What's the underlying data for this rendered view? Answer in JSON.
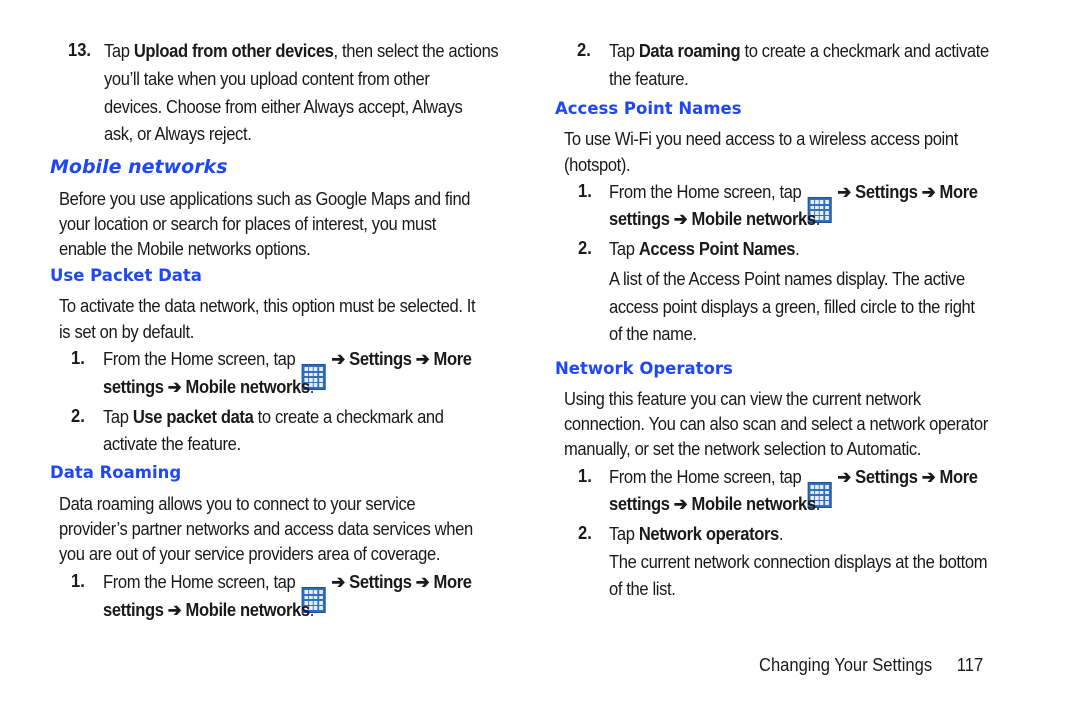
{
  "left_column": {
    "step13": {
      "number": "13.",
      "lines": [
        {
          "pre": "Tap ",
          "bold": "Upload from other devices",
          "post": ", then select the actions"
        },
        {
          "pre": "you’ll take when you upload content from other"
        },
        {
          "pre": "devices. Choose from either Always accept, Always"
        },
        {
          "pre": "ask, or Always reject."
        }
      ]
    },
    "mobile_networks": {
      "heading": "Mobile networks",
      "intro": [
        "Before you use applications such as Google Maps and find",
        "your location or search for places of interest, you must",
        "enable the Mobile networks options."
      ]
    },
    "use_packet_data": {
      "heading": "Use Packet Data",
      "intro": [
        "To activate the data network, this option must be selected. It",
        "is set on by default."
      ],
      "steps": [
        {
          "number": "1.",
          "line1_pre": "From the Home screen, tap ",
          "line1_post": " ➔ Settings ➔ More",
          "line2_bold": "settings ➔ Mobile networks",
          "line2_post": "."
        },
        {
          "number": "2.",
          "line1_pre": "Tap ",
          "line1_bold": "Use packet data",
          "line1_post": " to create a checkmark and",
          "line2": "activate the feature."
        }
      ]
    },
    "data_roaming": {
      "heading": "Data Roaming",
      "intro": [
        "Data roaming allows you to connect to your service",
        "provider’s partner networks and access data services when",
        "you are out of your service providers area of coverage."
      ],
      "steps": [
        {
          "number": "1.",
          "line1_pre": "From the Home screen, tap ",
          "line1_post": " ➔ Settings ➔ More",
          "line2_bold": "settings ➔ Mobile networks",
          "line2_post": "."
        }
      ]
    }
  },
  "right_column": {
    "data_roaming_step2": {
      "number": "2.",
      "line1_pre": "Tap ",
      "line1_bold": "Data roaming",
      "line1_post": " to create a checkmark and activate",
      "line2": "the feature."
    },
    "access_point_names": {
      "heading": "Access Point Names",
      "intro": [
        "To use Wi-Fi you need access to a wireless access point",
        "(hotspot)."
      ],
      "steps": [
        {
          "number": "1.",
          "line1_pre": "From the Home screen, tap ",
          "line1_post": " ➔ Settings ➔ More",
          "line2_bold": "settings ➔ Mobile networks",
          "line2_post": "."
        },
        {
          "number": "2.",
          "line1_pre": "Tap ",
          "line1_bold": "Access Point Names",
          "line1_post": "."
        }
      ],
      "note": [
        "A list of the Access Point names display. The active",
        "access point displays a green, filled circle to the right",
        "of the name."
      ]
    },
    "network_operators": {
      "heading": "Network Operators",
      "intro": [
        "Using this feature you can view the current network",
        "connection. You can also scan and select a network operator",
        "manually, or set the network selection to Automatic."
      ],
      "steps": [
        {
          "number": "1.",
          "line1_pre": "From the Home screen, tap ",
          "line1_post": " ➔ Settings ➔ More",
          "line2_bold": "settings ➔ Mobile networks",
          "line2_post": "."
        },
        {
          "number": "2.",
          "line1_pre": "Tap ",
          "line1_bold": "Network operators",
          "line1_post": "."
        }
      ],
      "note": [
        "The current network connection displays at the bottom",
        "of the list."
      ]
    }
  },
  "footer": {
    "section": "Changing Your Settings",
    "page": "117"
  },
  "icons": {
    "apps": "apps-grid-icon"
  },
  "colors": {
    "heading": "#1f47f5",
    "body_text": "#1a1a1a",
    "apps_icon": "#2f6fc0"
  }
}
